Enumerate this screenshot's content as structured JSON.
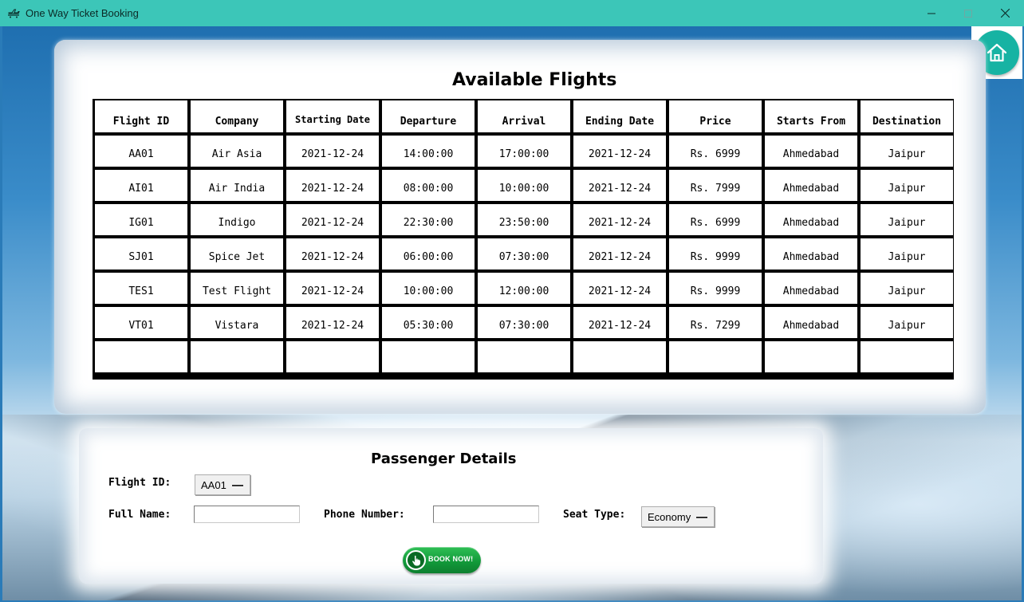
{
  "window": {
    "title": "One Way Ticket Booking"
  },
  "flights": {
    "heading": "Available Flights",
    "columns": [
      "Flight ID",
      "Company",
      "Starting Date",
      "Departure",
      "Arrival",
      "Ending Date",
      "Price",
      "Starts From",
      "Destination"
    ],
    "rows": [
      [
        "AA01",
        "Air Asia",
        "2021-12-24",
        "14:00:00",
        "17:00:00",
        "2021-12-24",
        "Rs. 6999",
        "Ahmedabad",
        "Jaipur"
      ],
      [
        "AI01",
        "Air India",
        "2021-12-24",
        "08:00:00",
        "10:00:00",
        "2021-12-24",
        "Rs. 7999",
        "Ahmedabad",
        "Jaipur"
      ],
      [
        "IG01",
        "Indigo",
        "2021-12-24",
        "22:30:00",
        "23:50:00",
        "2021-12-24",
        "Rs. 6999",
        "Ahmedabad",
        "Jaipur"
      ],
      [
        "SJ01",
        "Spice Jet",
        "2021-12-24",
        "06:00:00",
        "07:30:00",
        "2021-12-24",
        "Rs. 9999",
        "Ahmedabad",
        "Jaipur"
      ],
      [
        "TES1",
        "Test Flight",
        "2021-12-24",
        "10:00:00",
        "12:00:00",
        "2021-12-24",
        "Rs. 9999",
        "Ahmedabad",
        "Jaipur"
      ],
      [
        "VT01",
        "Vistara",
        "2021-12-24",
        "05:30:00",
        "07:30:00",
        "2021-12-24",
        "Rs. 7299",
        "Ahmedabad",
        "Jaipur"
      ],
      [
        "",
        "",
        "",
        "",
        "",
        "",
        "",
        "",
        ""
      ]
    ]
  },
  "passenger": {
    "heading": "Passenger Details",
    "flight_id_label": "Flight ID:",
    "flight_id_value": "AA01",
    "full_name_label": "Full Name:",
    "full_name_value": "",
    "phone_label": "Phone Number:",
    "phone_value": "",
    "seat_type_label": "Seat Type:",
    "seat_type_value": "Economy",
    "book_button": "BOOK NOW!"
  },
  "colors": {
    "titlebar": "#3cc6b8",
    "home_button": "#17b3a3",
    "book_button": "#129a3a"
  },
  "icons": {
    "app": "airplane-icon",
    "home": "home-icon",
    "book": "hand-pointer-icon"
  }
}
